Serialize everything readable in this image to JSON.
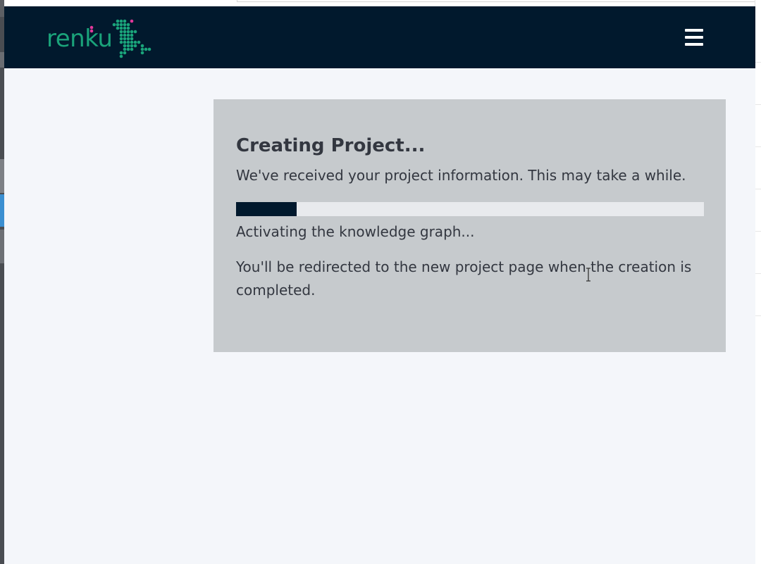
{
  "navbar": {
    "logo_text": "renku",
    "menu_icon": "hamburger-menu-icon",
    "background": "#01192d",
    "logo_color": "#1aa37a",
    "logo_accent": "#e2389a"
  },
  "creation": {
    "title": "Creating Project...",
    "lead": "We've received your project information. This may take a while.",
    "progress_percent": 13,
    "status": "Activating the knowledge graph...",
    "note": "You'll be redirected to the new project page when the creation is completed."
  },
  "icons": {
    "cursor": "text-cursor-icon"
  }
}
